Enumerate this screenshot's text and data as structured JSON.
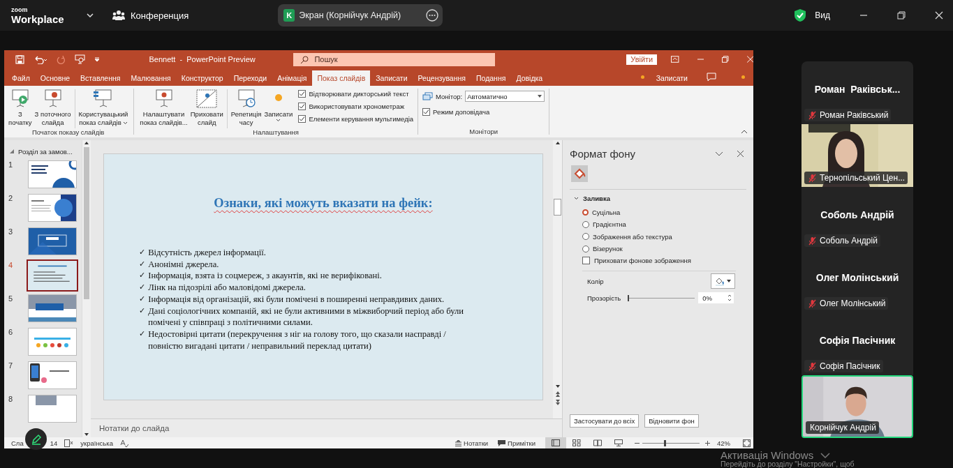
{
  "zoom_bar": {
    "logo_top": "zoom",
    "logo_bottom": "Workplace",
    "meeting": "Конференция",
    "share_initial": "K",
    "share_title": "Экран (Корнійчук Андрій)",
    "view": "Вид"
  },
  "ppt": {
    "title": "Bennett  -  PowerPoint Preview",
    "search": {
      "placeholder": "Пошук"
    },
    "signin": "Увійти",
    "tabs": [
      {
        "label": "Файл",
        "selected": false
      },
      {
        "label": "Основне",
        "selected": false
      },
      {
        "label": "Вставлення",
        "selected": false
      },
      {
        "label": "Малювання",
        "selected": false
      },
      {
        "label": "Конструктор",
        "selected": false
      },
      {
        "label": "Переходи",
        "selected": false
      },
      {
        "label": "Анімація",
        "selected": false
      },
      {
        "label": "Показ слайдів",
        "selected": true
      },
      {
        "label": "Записати",
        "selected": false
      },
      {
        "label": "Рецензування",
        "selected": false
      },
      {
        "label": "Подання",
        "selected": false
      },
      {
        "label": "Довідка",
        "selected": false
      }
    ],
    "record": "Записати",
    "ribbon": {
      "start_group": {
        "label": "Початок показу слайдів",
        "buttons": [
          {
            "label": "З\nпочатку",
            "kind": "start"
          },
          {
            "label": "З поточного\nслайда",
            "kind": "current"
          },
          {
            "label": "Користувацький\nпоказ слайдів",
            "kind": "custom"
          }
        ]
      },
      "setup_group": {
        "label": "Налаштування",
        "buttons": [
          {
            "label": "Налаштувати\nпоказ слайдів...",
            "kind": "setup"
          },
          {
            "label": "Приховати\nслайд",
            "kind": "hide"
          },
          {
            "label": "Репетиція\nчасу",
            "kind": "rehearse"
          },
          {
            "label": "Записати",
            "kind": "record"
          }
        ],
        "checkboxes": [
          {
            "label": "Відтворювати дикторський текст",
            "checked": true
          },
          {
            "label": "Використовувати хронометраж",
            "checked": true
          },
          {
            "label": "Елементи керування мультимедіа",
            "checked": true
          }
        ]
      },
      "monitors_group": {
        "label": "Монітори",
        "monitor_label": "Монітор:",
        "monitor_value": "Автоматично",
        "presenter": {
          "label": "Режим доповідача",
          "checked": true
        }
      }
    },
    "slides_panel": {
      "section": "Розділ за замов...",
      "slides": [
        {
          "number": "1",
          "selected": false
        },
        {
          "number": "2",
          "selected": false
        },
        {
          "number": "3",
          "selected": false
        },
        {
          "number": "4",
          "selected": true
        },
        {
          "number": "5",
          "selected": false
        },
        {
          "number": "6",
          "selected": false
        },
        {
          "number": "7",
          "selected": false
        },
        {
          "number": "8",
          "selected": false
        }
      ]
    },
    "slide": {
      "title": "Ознаки, які можуть вказати на фейк:",
      "bullets": [
        {
          "mark": "✓",
          "text": "Відсутність джерел інформації."
        },
        {
          "mark": "✓",
          "text": "Анонімні джерела."
        },
        {
          "mark": "✓",
          "text": "Інформація, взята із соцмереж, з акаунтів, які не верифіковані."
        },
        {
          "mark": "✓",
          "text": "Лінк на підозрілі або маловідомі джерела."
        },
        {
          "mark": "✓",
          "text": "Інформація від організацій, які були помічені в поширенні неправдивих даних."
        },
        {
          "mark": "✓",
          "text": "Дані соціологічних компаній, які не були активними в міжвиборчий період або були\nпомічені у співпраці з політичними силами."
        },
        {
          "mark": "✓",
          "text": "Недостовірні цитати (перекручення з ніг на голову того, що сказали насправді /\nповністю вигадані цитати / неправильний переклад цитати)"
        }
      ]
    },
    "notes": "Нотатки до слайда",
    "format_pane": {
      "title": "Формат фону",
      "section": "Заливка",
      "fill_options": [
        {
          "label": "Суцільна",
          "selected": true
        },
        {
          "label": "Градієнтна",
          "selected": false
        },
        {
          "label": "Зображення або текстура",
          "selected": false
        },
        {
          "label": "Візерунок",
          "selected": false
        }
      ],
      "hide_background": {
        "label": "Приховати фонове зображення",
        "checked": false
      },
      "color_label": "Колір",
      "transparency": {
        "label": "Прозорість",
        "level": 0,
        "value": "0%"
      },
      "buttons": [
        "Застосувати до всіх",
        "Відновити фон"
      ]
    },
    "status_bar": {
      "slide_start": "Сла",
      "slide_end": "14",
      "language": "українська",
      "notes": "Нотатки",
      "comments": "Примітки",
      "zoom": {
        "level": 0.38,
        "value": "42%"
      }
    }
  },
  "participants": [
    {
      "kind": "name",
      "display_name": "Роман  Раківськ...",
      "label": "Роман Раківський",
      "muted": true,
      "active": false
    },
    {
      "kind": "video",
      "label": "Тернопільський Цен...",
      "muted": true,
      "active": false
    },
    {
      "kind": "name",
      "display_name": "Соболь Андрій",
      "label": "Соболь Андрій",
      "muted": true,
      "active": false
    },
    {
      "kind": "name",
      "display_name": "Олег Молінський",
      "label": "Олег Молінський",
      "muted": true,
      "active": false
    },
    {
      "kind": "name",
      "display_name": "Софія Пасічник",
      "label": "Софія Пасічник",
      "muted": true,
      "active": false
    },
    {
      "kind": "video",
      "label": "Корнійчук Андрій",
      "muted": false,
      "active": true
    }
  ],
  "os_notice": {
    "title": "Активація Windows",
    "text": "Перейдіть до розділу \"Настройки\", щоб"
  }
}
